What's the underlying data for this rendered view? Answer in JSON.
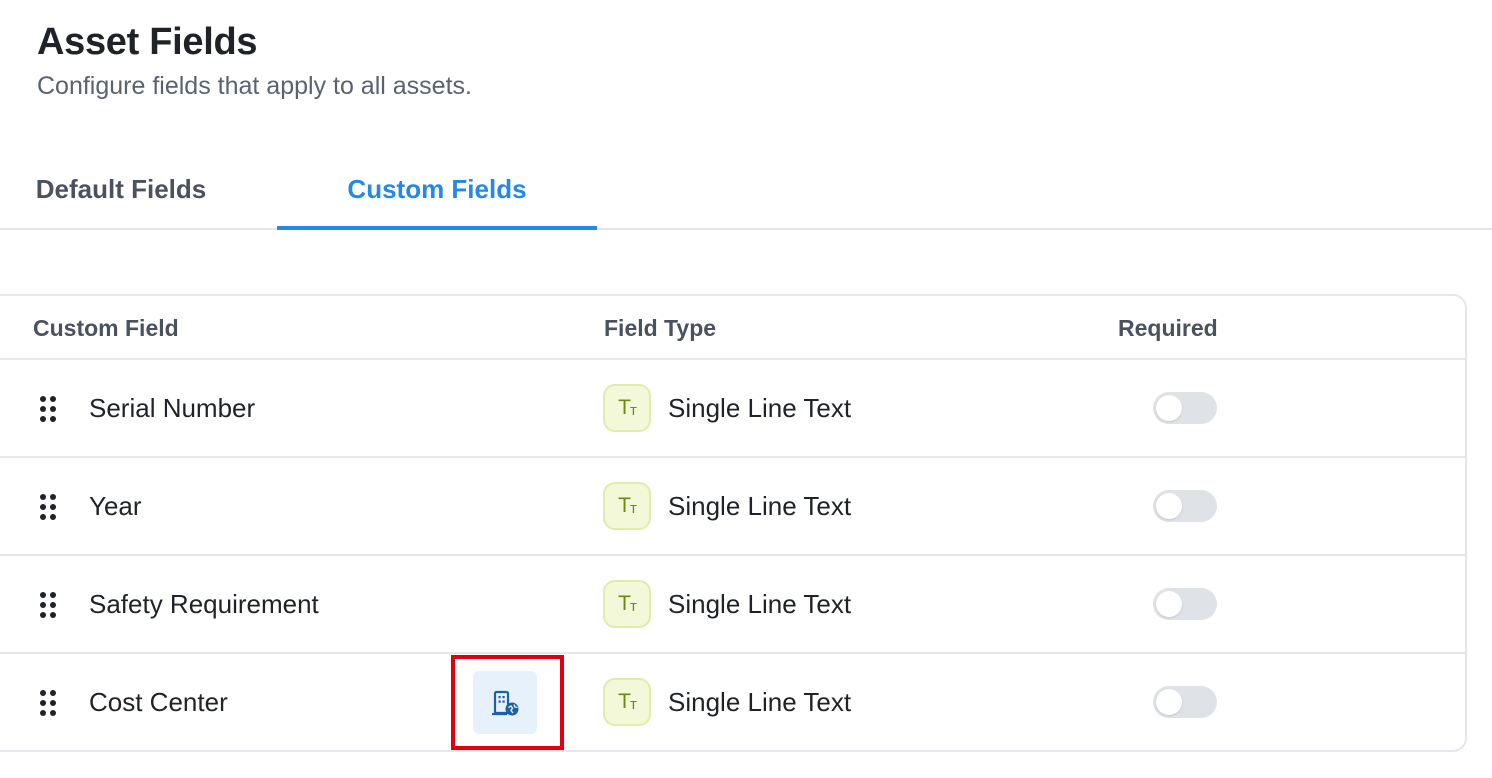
{
  "header": {
    "title": "Asset Fields",
    "subtitle": "Configure fields that apply to all assets."
  },
  "tabs": [
    {
      "label": "Default Fields",
      "active": false
    },
    {
      "label": "Custom Fields",
      "active": true
    }
  ],
  "table": {
    "columns": {
      "field": "Custom Field",
      "type": "Field Type",
      "required": "Required"
    },
    "rows": [
      {
        "name": "Serial Number",
        "type": "Single Line Text",
        "required": false
      },
      {
        "name": "Year",
        "type": "Single Line Text",
        "required": false
      },
      {
        "name": "Safety Requirement",
        "type": "Single Line Text",
        "required": false
      },
      {
        "name": "Cost Center",
        "type": "Single Line Text",
        "required": false,
        "action_icon": "building-globe-icon"
      }
    ]
  },
  "type_icon_glyph": "Tт",
  "colors": {
    "accent": "#2388e8",
    "highlight": "#e1000f",
    "type_icon_bg": "#f3f8d9",
    "type_icon_fg": "#6d8a10",
    "toggle_off": "#dfe2e6"
  }
}
